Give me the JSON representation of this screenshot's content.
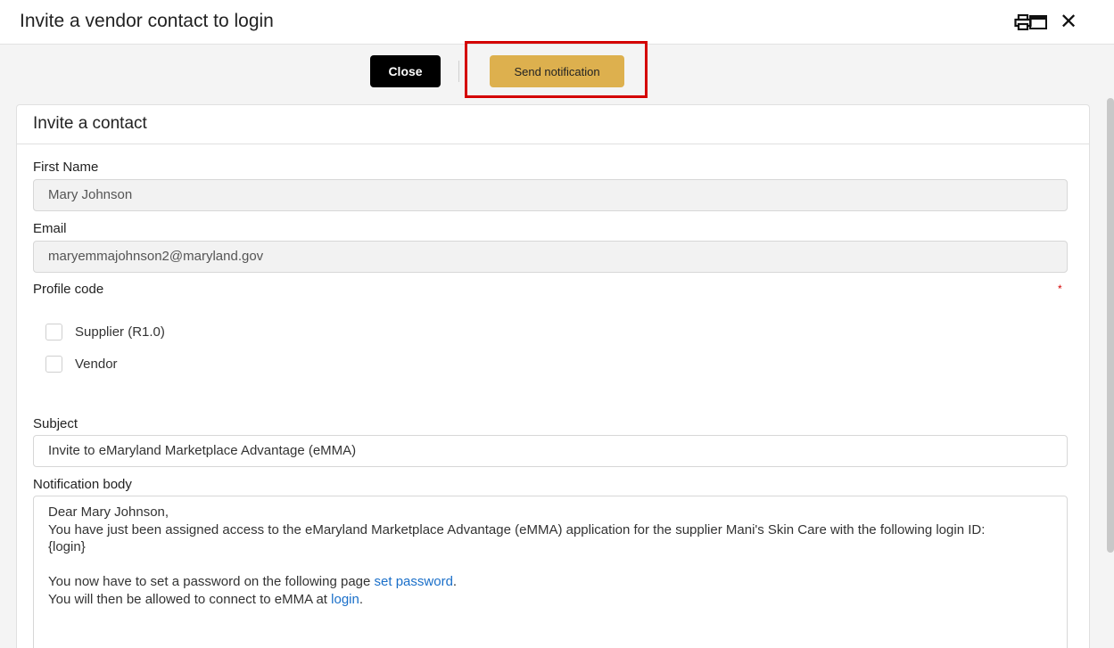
{
  "window": {
    "title": "Invite a vendor contact to login"
  },
  "toolbar": {
    "close_label": "Close",
    "send_label": "Send notification"
  },
  "panel": {
    "title": "Invite a contact"
  },
  "form": {
    "first_name_label": "First Name",
    "first_name_value": "Mary Johnson",
    "email_label": "Email",
    "email_value": "maryemmajohnson2@maryland.gov",
    "profile_code_label": "Profile code",
    "required_mark": "*",
    "profile_options": [
      "Supplier (R1.0)",
      "Vendor"
    ],
    "subject_label": "Subject",
    "subject_value": "Invite to eMaryland Marketplace Advantage (eMMA)",
    "body_label": "Notification body",
    "body": {
      "greeting": "Dear Mary Johnson,",
      "line1": "You have just been assigned access to the eMaryland Marketplace Advantage (eMMA) application for the supplier Mani's Skin Care with the following login ID:",
      "login_placeholder": "{login}",
      "line2_prefix": "You now have to set a password on the following page ",
      "set_password_link": "set password",
      "line2_suffix": ".",
      "line3_prefix": "You will then be allowed to connect to eMMA at ",
      "login_link": "login",
      "line3_suffix": "."
    }
  },
  "icons": {
    "print": "print-icon",
    "maximize": "maximize-icon",
    "close": "close-icon"
  },
  "colors": {
    "send_button": "#ddb04e",
    "close_button": "#000000",
    "highlight": "#d40000",
    "link": "#1a6fc9"
  }
}
